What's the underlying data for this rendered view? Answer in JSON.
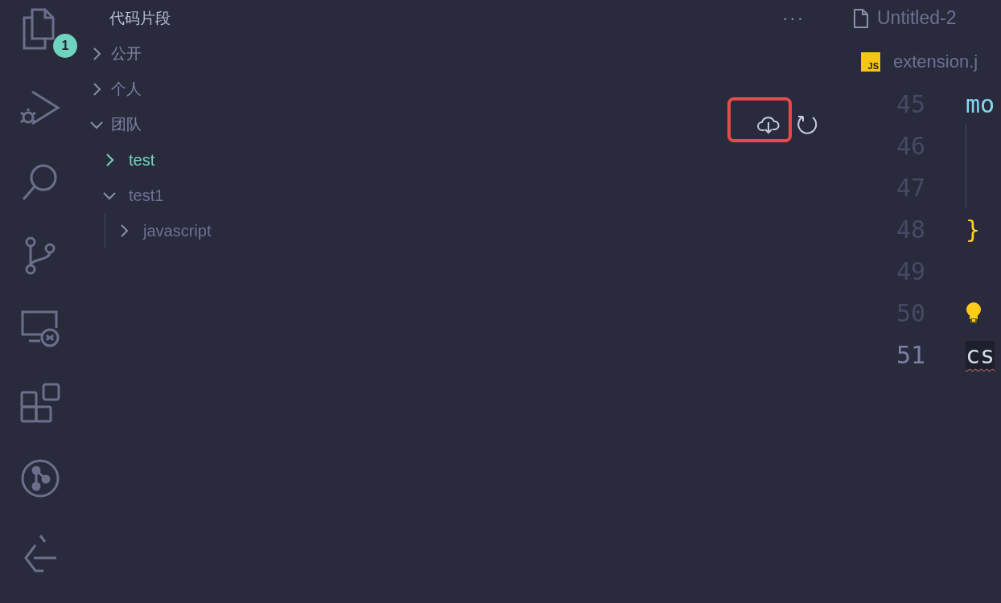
{
  "activity_bar": {
    "items": [
      {
        "kind": "files",
        "badge": "1"
      },
      {
        "kind": "debug"
      },
      {
        "kind": "search"
      },
      {
        "kind": "scm"
      },
      {
        "kind": "remote"
      },
      {
        "kind": "extensions"
      },
      {
        "kind": "graph"
      },
      {
        "kind": "last"
      }
    ]
  },
  "sidebar": {
    "title": "代码片段",
    "more": "···",
    "tree": [
      {
        "label": "公开",
        "expanded": false,
        "selected": false,
        "hovered": false
      },
      {
        "label": "个人",
        "expanded": false,
        "selected": false,
        "hovered": false
      },
      {
        "label": "团队",
        "expanded": true,
        "selected": false,
        "hovered": true,
        "children": [
          {
            "label": "test",
            "expanded": false,
            "selected": true,
            "hovered": false
          },
          {
            "label": "test1",
            "expanded": true,
            "selected": false,
            "hovered": false,
            "children": [
              {
                "label": "javascript",
                "expanded": false,
                "selected": false,
                "hovered": false
              }
            ]
          }
        ]
      }
    ]
  },
  "editor": {
    "tabs": [
      {
        "label": "Untitled-2",
        "kind": "file"
      },
      {
        "label": "extension.j",
        "kind": "js",
        "badge": "JS"
      }
    ],
    "lines": [
      {
        "number": "45",
        "text": "mo",
        "kind": "keyword",
        "active": false
      },
      {
        "number": "46",
        "kind": "indented",
        "active": false
      },
      {
        "number": "47",
        "kind": "indented",
        "active": false
      },
      {
        "number": "48",
        "text": "}",
        "kind": "brace",
        "active": false
      },
      {
        "number": "49",
        "kind": "empty",
        "active": false
      },
      {
        "number": "50",
        "kind": "lightbulb",
        "active": false
      },
      {
        "number": "51",
        "text": "cs",
        "kind": "error",
        "active": true
      }
    ]
  }
}
